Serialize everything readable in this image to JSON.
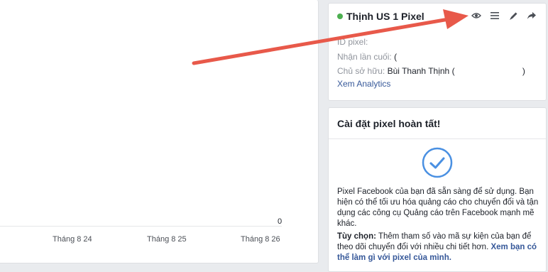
{
  "chart": {
    "zero_label": "0",
    "x_ticks": [
      "Tháng 8 24",
      "Tháng 8 25",
      "Tháng 8 26"
    ]
  },
  "pixel_card": {
    "title": "Thịnh US 1 Pixel",
    "status_color": "#4caf50",
    "actions": [
      "eye-icon",
      "list-icon",
      "pencil-icon",
      "share-icon"
    ],
    "id_label": "ID pixel:",
    "id_value": "",
    "last_received_label": "Nhận lần cuối:",
    "last_received_value": "(",
    "owner_label": "Chủ sở hữu:",
    "owner_value_prefix": "Bùi Thanh Thịnh (",
    "owner_value_suffix": ")",
    "analytics_link": "Xem Analytics"
  },
  "setup_card": {
    "title": "Cài đặt pixel hoàn tất!",
    "check_icon": "check-circle-icon",
    "body_text": "Pixel Facebook của bạn đã sẵn sàng để sử dụng. Bạn hiện có thể tối ưu hóa quảng cáo cho chuyển đổi và tận dụng các công cụ Quảng cáo trên Facebook mạnh mẽ khác.",
    "optional_label": "Tùy chọn:",
    "optional_text": "Thêm tham số vào mã sự kiện của bạn để theo dõi chuyển đổi với nhiều chi tiết hơn.",
    "optional_link": "Xem bạn có thể làm gì với pixel của mình."
  },
  "colors": {
    "accent_link": "#365899",
    "annotation_arrow": "#e8594a",
    "check_blue": "#4a90e2"
  }
}
